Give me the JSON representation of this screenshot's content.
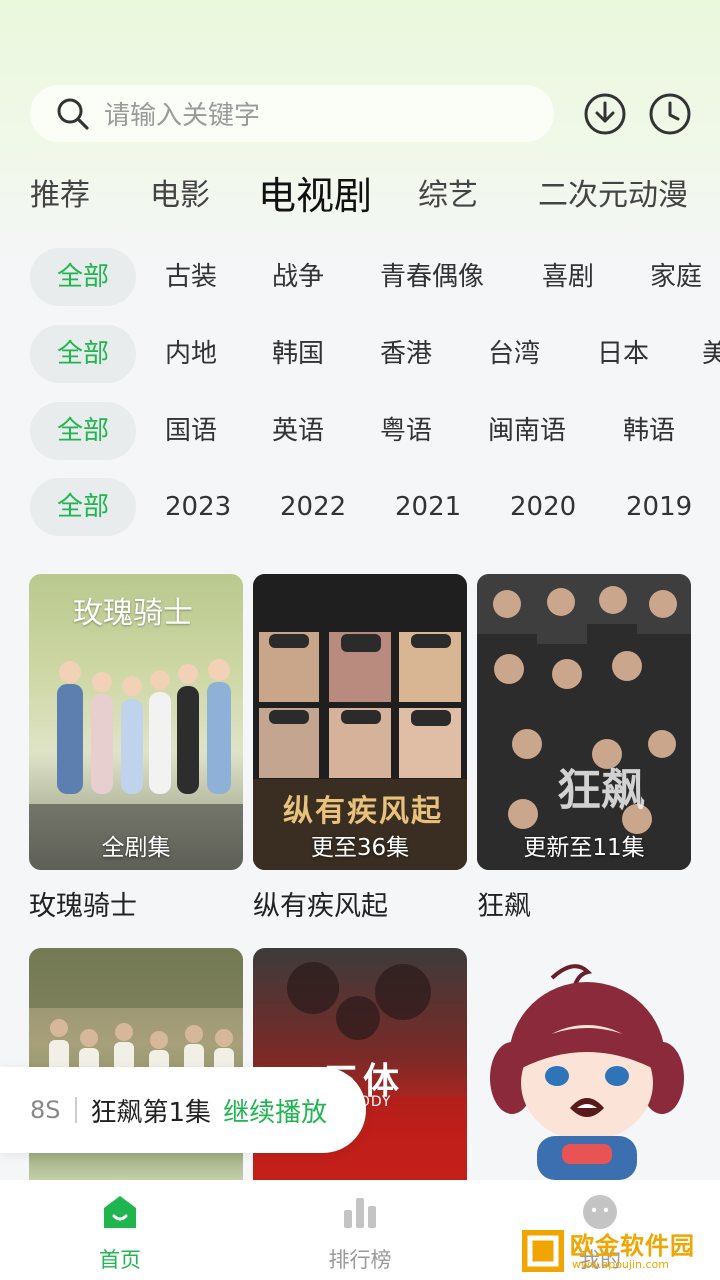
{
  "search": {
    "placeholder": "请输入关键字"
  },
  "categories": [
    "推荐",
    "电影",
    "电视剧",
    "综艺",
    "二次元动漫"
  ],
  "filters": {
    "type": [
      "全部",
      "古装",
      "战争",
      "青春偶像",
      "喜剧",
      "家庭"
    ],
    "region": [
      "全部",
      "内地",
      "韩国",
      "香港",
      "台湾",
      "日本",
      "美"
    ],
    "language": [
      "全部",
      "国语",
      "英语",
      "粤语",
      "闽南语",
      "韩语"
    ],
    "year": [
      "全部",
      "2023",
      "2022",
      "2021",
      "2020",
      "2019"
    ]
  },
  "shows": [
    {
      "title": "玫瑰骑士",
      "badge": "全剧集",
      "poster_text": "玫瑰骑士"
    },
    {
      "title": "纵有疾风起",
      "badge": "更至36集",
      "poster_text": "纵有疾风起"
    },
    {
      "title": "狂飙",
      "badge": "更新至11集",
      "poster_text": "狂飙"
    }
  ],
  "shows_row2": [
    {
      "poster_text": "三体",
      "poster_sub": "3-BODY"
    }
  ],
  "resume": {
    "time": "8S",
    "episode": "狂飙第1集",
    "action": "继续播放"
  },
  "bottom_nav": [
    {
      "label": "首页",
      "icon": "home-icon"
    },
    {
      "label": "排行榜",
      "icon": "chart-icon"
    },
    {
      "label": "我的",
      "icon": "face-icon"
    }
  ],
  "watermark": {
    "text": "欧金软件园",
    "url": "www.apoujin.com"
  },
  "colors": {
    "accent": "#1fb650"
  }
}
